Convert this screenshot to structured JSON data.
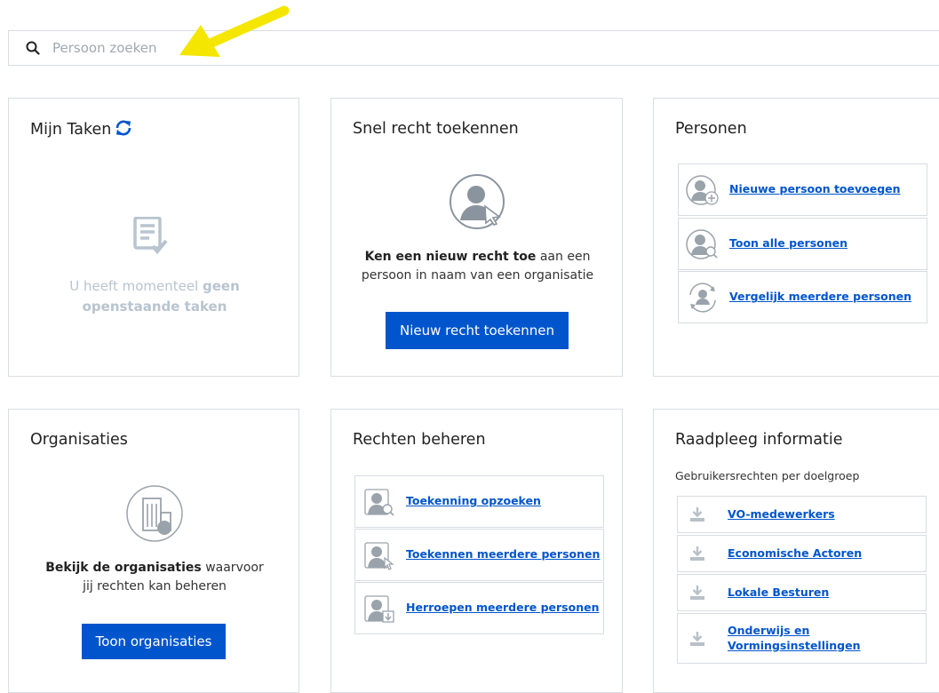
{
  "search": {
    "placeholder": "Persoon zoeken"
  },
  "tasks": {
    "title": "Mijn Taken",
    "empty_prefix": "U heeft momenteel ",
    "empty_bold": "geen openstaande taken"
  },
  "quick_grant": {
    "title": "Snel recht toekennen",
    "desc_bold": "Ken een nieuw recht toe",
    "desc_rest": " aan een persoon in naam van een organisatie",
    "button": "Nieuw recht toekennen"
  },
  "persons": {
    "title": "Personen",
    "items": [
      {
        "label": "Nieuwe persoon toevoegen",
        "icon": "person-add-icon"
      },
      {
        "label": "Toon alle personen",
        "icon": "person-search-icon"
      },
      {
        "label": "Vergelijk meerdere personen",
        "icon": "person-compare-icon"
      }
    ]
  },
  "organisations": {
    "title": "Organisaties",
    "desc_bold": "Bekijk de organisaties",
    "desc_rest": " waarvoor jij rechten kan beheren",
    "button": "Toon organisaties"
  },
  "rights": {
    "title": "Rechten beheren",
    "items": [
      {
        "label": "Toekenning opzoeken",
        "icon": "grant-search-icon"
      },
      {
        "label": "Toekennen meerdere personen",
        "icon": "grant-multiple-icon"
      },
      {
        "label": "Herroepen meerdere personen",
        "icon": "revoke-multiple-icon"
      }
    ]
  },
  "info": {
    "title": "Raadpleeg informatie",
    "subtitle": "Gebruikersrechten per doelgroep",
    "items": [
      {
        "label": "VO-medewerkers",
        "icon": "download-icon"
      },
      {
        "label": "Economische Actoren",
        "icon": "download-icon"
      },
      {
        "label": "Lokale Besturen",
        "icon": "download-icon"
      },
      {
        "label": "Onderwijs en Vormingsinstellingen",
        "icon": "download-icon"
      }
    ]
  },
  "colors": {
    "primary": "#0055cc",
    "border": "#d8dde3",
    "muted": "#b8c4cf",
    "arrow": "#f5e600"
  }
}
